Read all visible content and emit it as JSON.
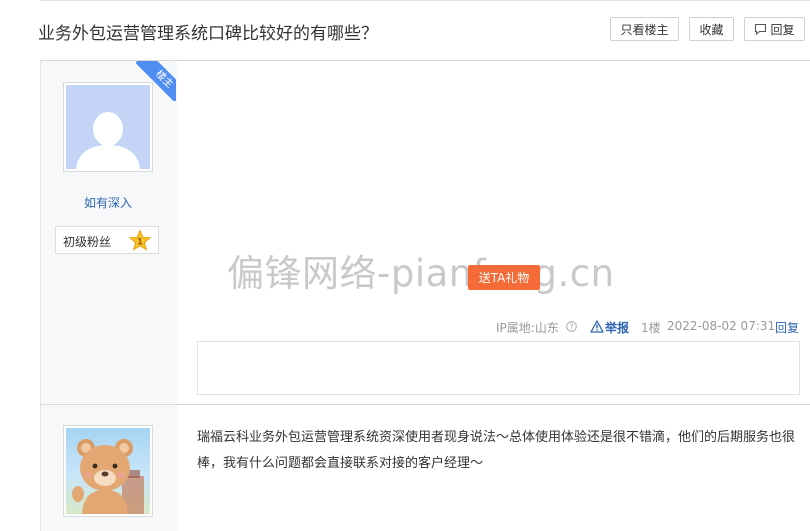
{
  "thread": {
    "title": "业务外包运营管理系统口碑比较好的有哪些？"
  },
  "toolbar": {
    "only_op_label": "只看楼主",
    "favorite_label": "收藏",
    "reply_label": "回复"
  },
  "post1": {
    "op_badge": "楼主",
    "username": "如有深入",
    "fan_level_label": "初级粉丝",
    "fan_level_number": "1",
    "gift_label": "送TA礼物",
    "ip_location": "IP属地:山东",
    "report_label": "举报",
    "floor": "1楼",
    "timestamp": "2022-08-02 07:31",
    "reply_label": "回复"
  },
  "post2": {
    "content": "瑞福云科业务外包运营管理系统资深使用者现身说法～总体使用体验还是很不错滴，他们的后期服务也很棒，我有什么问题都会直接联系对接的客户经理～"
  },
  "watermark": {
    "text": "偏锋网络-pianfeng.cn"
  },
  "colors": {
    "link_blue": "#2d64b3",
    "gift_orange": "#f46b38",
    "badge_blue": "#4f8df2",
    "avatar_placeholder": "#c4d4f6"
  },
  "icons": {
    "reply_button": "speech-bubble-icon",
    "fan_badge": "star-icon",
    "ip_help": "question-circle-icon",
    "report": "warning-triangle-icon"
  }
}
